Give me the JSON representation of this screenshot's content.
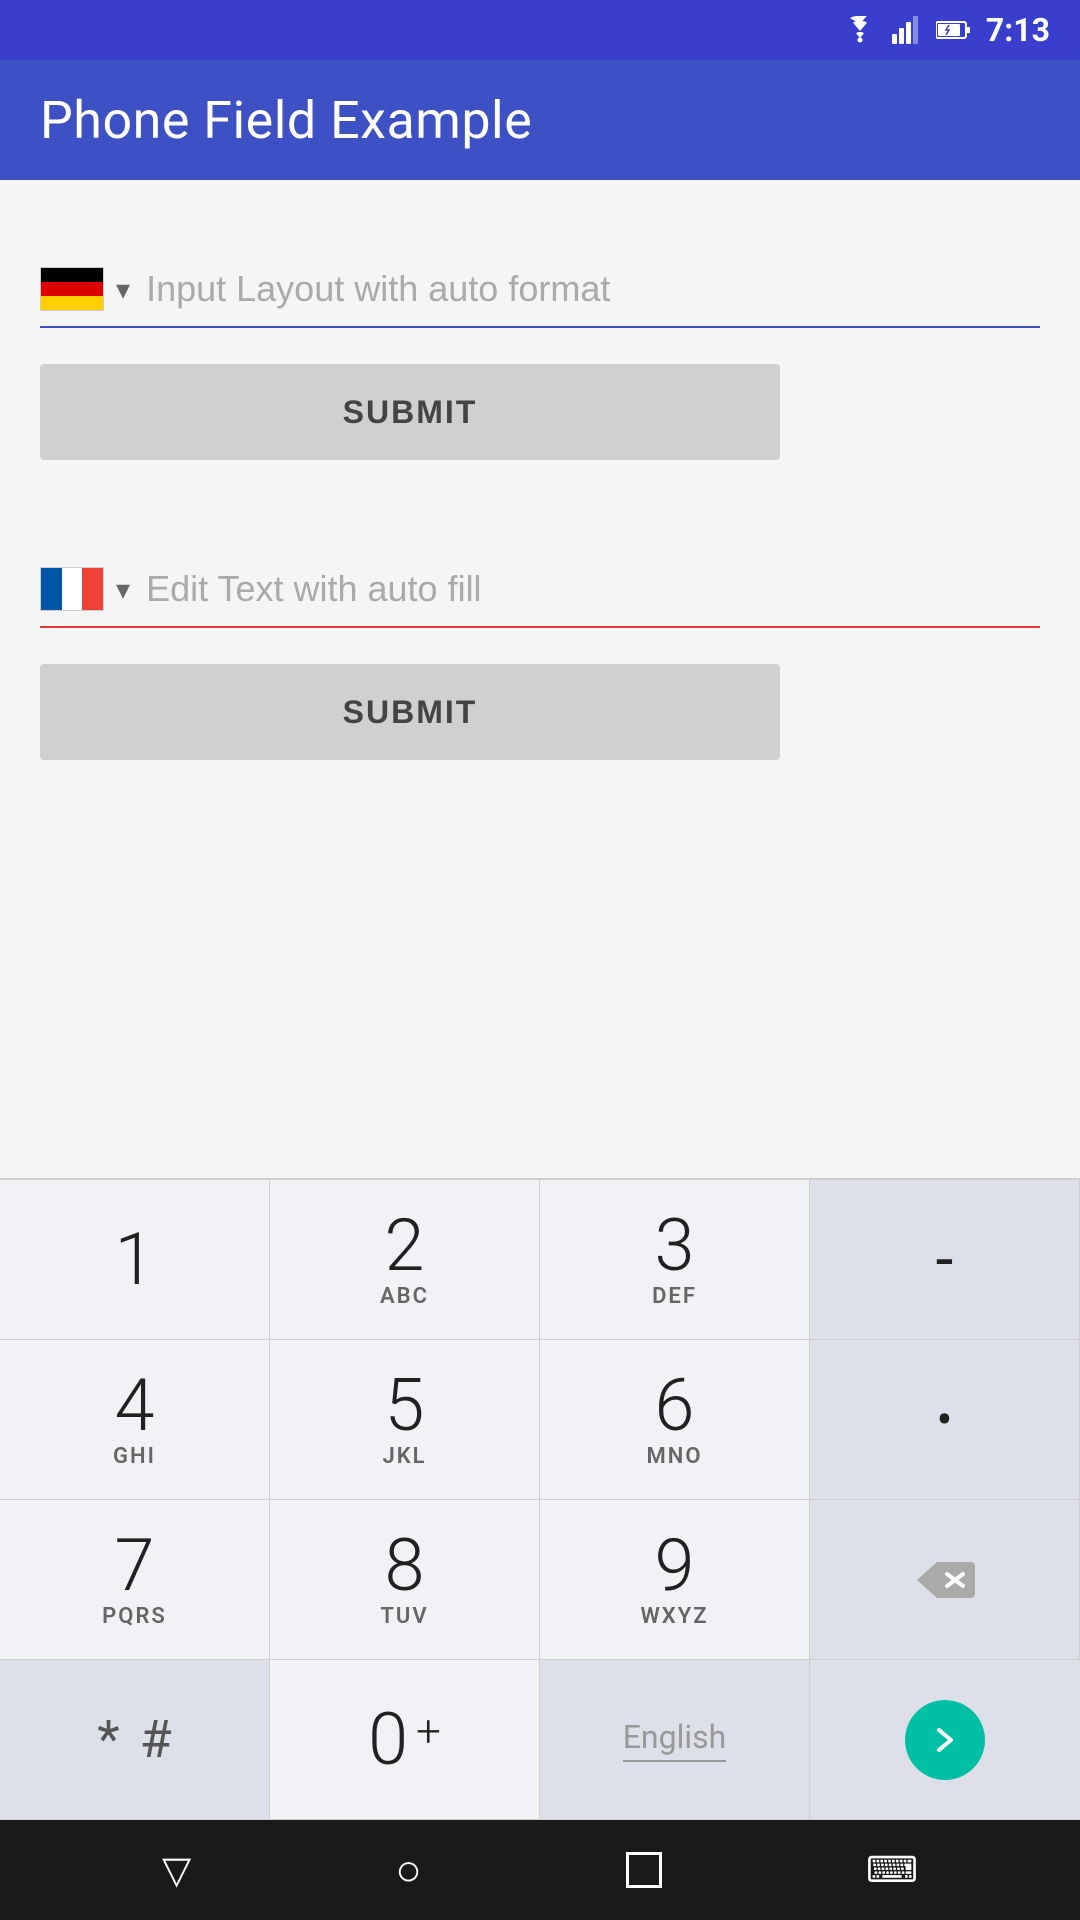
{
  "status_bar": {
    "time": "7:13"
  },
  "app_bar": {
    "title": "Phone Field Example"
  },
  "form1": {
    "flag_country": "Germany",
    "placeholder": "Input Layout with auto format",
    "submit_label": "SUBMIT"
  },
  "form2": {
    "flag_country": "France",
    "placeholder": "Edit Text with auto fill",
    "submit_label": "SUBMIT"
  },
  "keyboard": {
    "row1": [
      {
        "main": "1",
        "sub": ""
      },
      {
        "main": "2",
        "sub": "ABC"
      },
      {
        "main": "3",
        "sub": "DEF"
      },
      {
        "main": "-",
        "sub": ""
      }
    ],
    "row2": [
      {
        "main": "4",
        "sub": "GHI"
      },
      {
        "main": "5",
        "sub": "JKL"
      },
      {
        "main": "6",
        "sub": "MNO"
      },
      {
        "main": ".",
        "sub": ""
      }
    ],
    "row3": [
      {
        "main": "7",
        "sub": "PQRS"
      },
      {
        "main": "8",
        "sub": "TUV"
      },
      {
        "main": "9",
        "sub": "WXYZ"
      },
      {
        "main": "⌫",
        "sub": ""
      }
    ],
    "row4": [
      {
        "main": "*#",
        "sub": ""
      },
      {
        "main": "0+",
        "sub": ""
      },
      {
        "main": "English",
        "sub": ""
      },
      {
        "main": "→",
        "sub": ""
      }
    ]
  },
  "nav": {
    "back_icon": "▽",
    "home_icon": "○",
    "recents_icon": "□",
    "keyboard_icon": "⌨"
  }
}
